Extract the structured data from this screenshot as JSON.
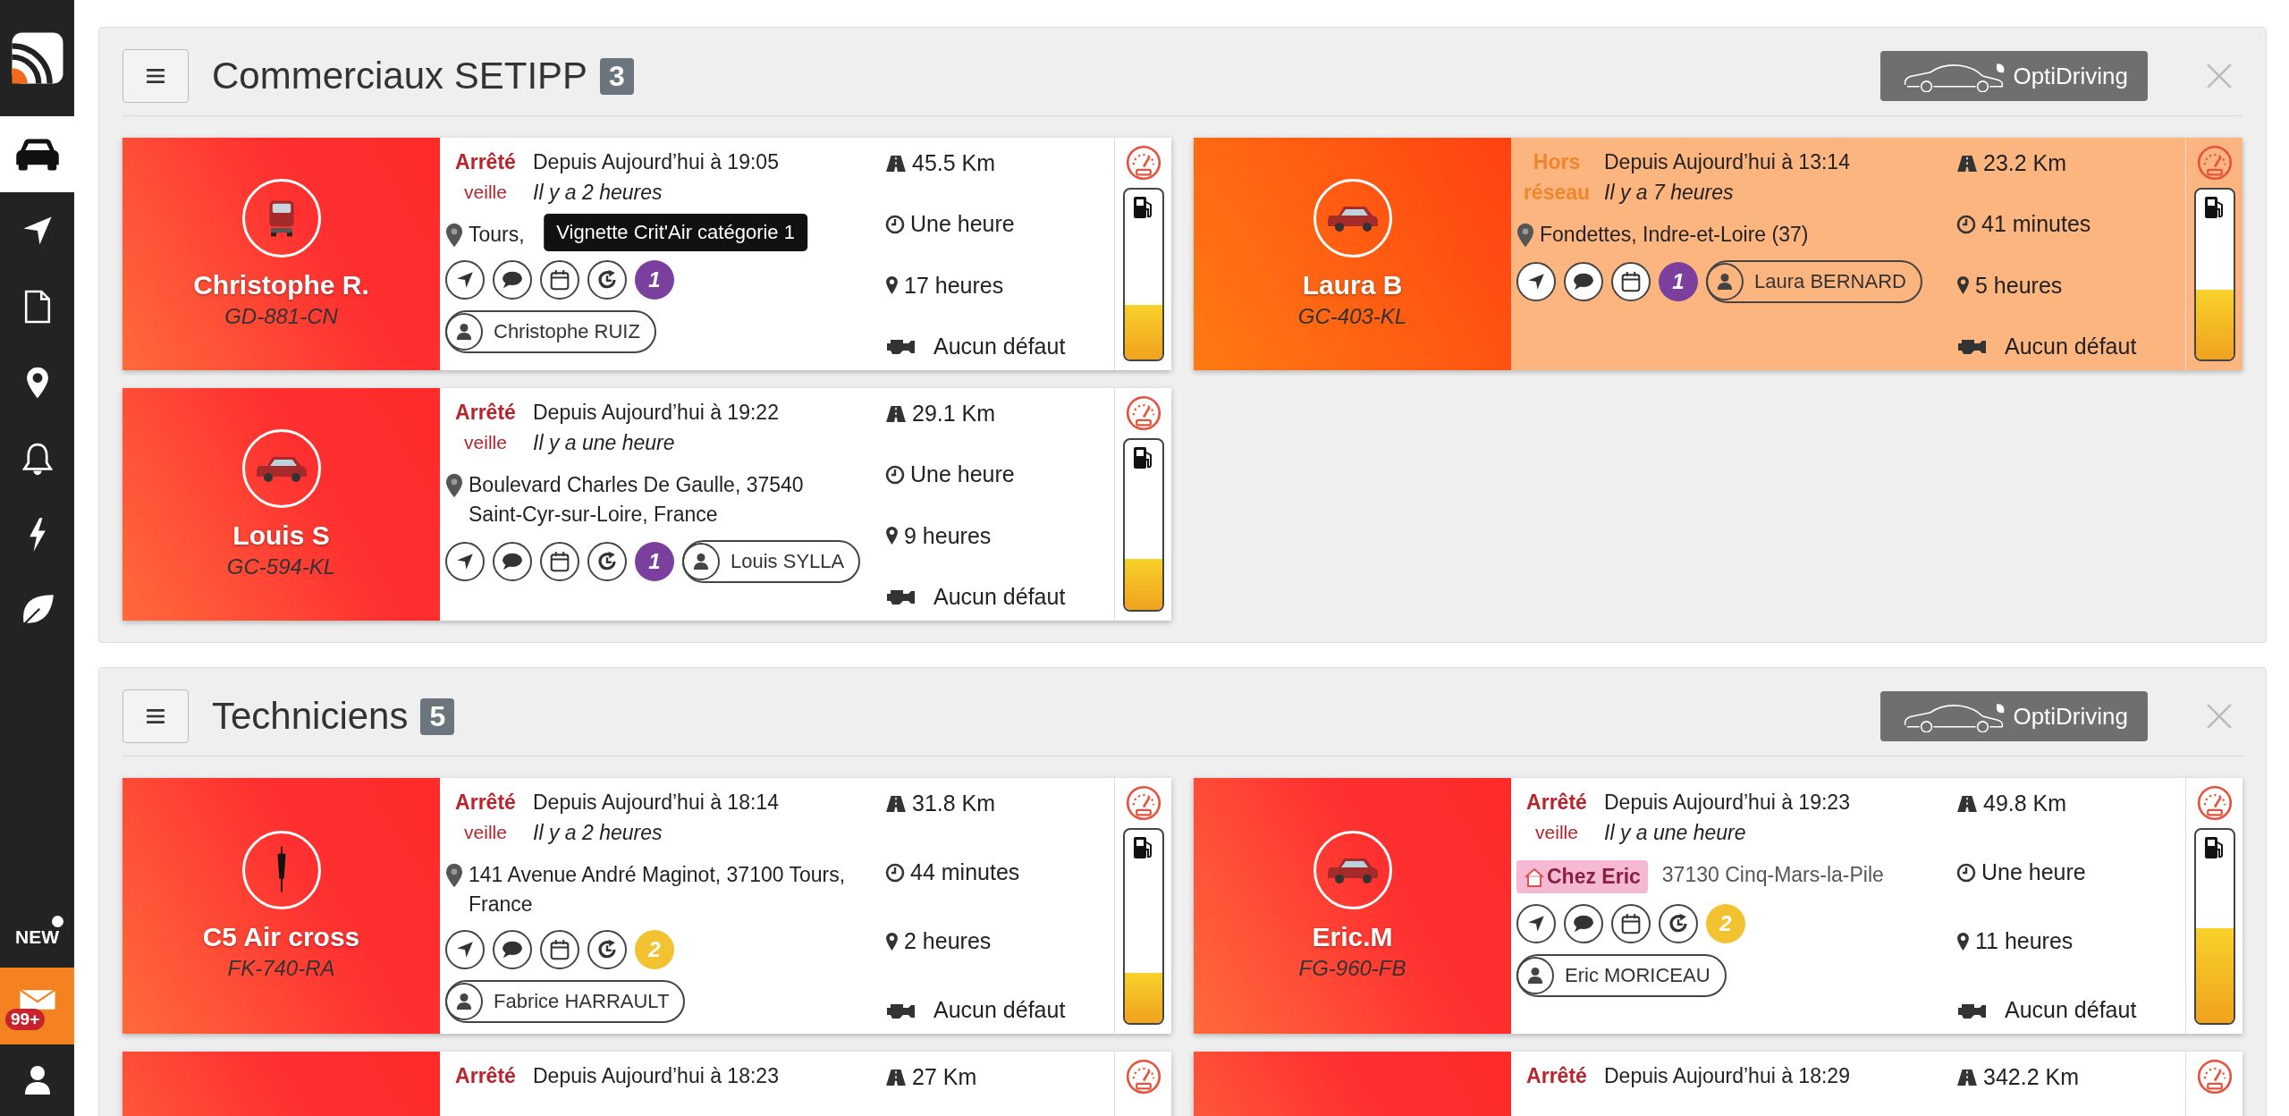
{
  "sidebar": {
    "nav": [
      {
        "kind": "car",
        "selected": true
      },
      {
        "kind": "navigate",
        "selected": false
      },
      {
        "kind": "document",
        "selected": false
      },
      {
        "kind": "pin",
        "selected": false
      },
      {
        "kind": "bell",
        "selected": false
      },
      {
        "kind": "bolt",
        "selected": false
      },
      {
        "kind": "leaf",
        "selected": false
      }
    ],
    "new_label": "NEW",
    "mail_badge": "99+"
  },
  "groups": [
    {
      "title": "Commerciaux SETIPP",
      "count": "3",
      "optidriving": "OptiDriving",
      "cards": [
        {
          "name": "Christophe R.",
          "plate": "GD-881-CN",
          "avatar": {
            "kind": "truck"
          },
          "status": {
            "kind": "stopped",
            "label": "Arrêté",
            "sub": "veille"
          },
          "since": "Depuis Aujourd’hui à 19:05",
          "ago": "Il y a 2 heures",
          "address": [
            "Tours,"
          ],
          "tooltip": "Vignette Crit'Air catégorie 1",
          "actions": [
            {
              "kind": "navigate"
            },
            {
              "kind": "message"
            },
            {
              "kind": "calendar"
            },
            {
              "kind": "history"
            }
          ],
          "critair": {
            "label": "1",
            "color": "#7b3f9e"
          },
          "driver": "Christophe RUIZ",
          "distance": "45.5 Km",
          "duration": "Une heure",
          "stop_time": "17 heures",
          "faults": "Aucun défaut",
          "fuel": {
            "level": 0.32
          }
        },
        {
          "name": "Laura B",
          "plate": "GC-403-KL",
          "avatar": {
            "kind": "car"
          },
          "status": {
            "kind": "offline",
            "label": "Hors réseau"
          },
          "since": "Depuis Aujourd’hui à 13:14",
          "ago": "Il y a 7 heures",
          "address": [
            "Fondettes, Indre-et-Loire (37)"
          ],
          "actions": [
            {
              "kind": "navigate"
            },
            {
              "kind": "message"
            },
            {
              "kind": "calendar"
            }
          ],
          "critair": {
            "label": "1",
            "color": "#7b3f9e"
          },
          "driver": "Laura BERNARD",
          "distance": "23.2 Km",
          "duration": "41 minutes",
          "stop_time": "5 heures",
          "faults": "Aucun défaut",
          "fuel": {
            "level": 0.41
          }
        },
        {
          "name": "Louis S",
          "plate": "GC-594-KL",
          "avatar": {
            "kind": "car"
          },
          "status": {
            "kind": "stopped",
            "label": "Arrêté",
            "sub": "veille"
          },
          "since": "Depuis Aujourd’hui à 19:22",
          "ago": "Il y a une heure",
          "address": [
            "Boulevard Charles De Gaulle, 37540",
            "Saint-Cyr-sur-Loire, France"
          ],
          "actions": [
            {
              "kind": "navigate"
            },
            {
              "kind": "message"
            },
            {
              "kind": "calendar"
            },
            {
              "kind": "history"
            }
          ],
          "critair": {
            "label": "1",
            "color": "#7b3f9e"
          },
          "driver": "Louis SYLLA",
          "distance": "29.1 Km",
          "duration": "Une heure",
          "stop_time": "9 heures",
          "faults": "Aucun défaut",
          "fuel": {
            "level": 0.3
          }
        }
      ]
    },
    {
      "title": "Techniciens",
      "count": "5",
      "optidriving": "OptiDriving",
      "cards": [
        {
          "name": "C5 Air cross",
          "plate": "FK-740-RA",
          "avatar": {
            "kind": "tool"
          },
          "status": {
            "kind": "stopped",
            "label": "Arrêté",
            "sub": "veille"
          },
          "since": "Depuis Aujourd’hui à 18:14",
          "ago": "Il y a 2 heures",
          "address": [
            "141 Avenue André Maginot, 37100 Tours,",
            "France"
          ],
          "actions": [
            {
              "kind": "navigate"
            },
            {
              "kind": "message"
            },
            {
              "kind": "calendar"
            },
            {
              "kind": "history"
            }
          ],
          "critair": {
            "label": "2",
            "color": "#f2c230"
          },
          "driver": "Fabrice HARRAULT",
          "distance": "31.8 Km",
          "duration": "44 minutes",
          "stop_time": "2 heures",
          "faults": "Aucun défaut",
          "fuel": {
            "level": 0.26
          }
        },
        {
          "name": "Eric.M",
          "plate": "FG-960-FB",
          "avatar": {
            "kind": "car"
          },
          "status": {
            "kind": "stopped",
            "label": "Arrêté",
            "sub": "veille"
          },
          "since": "Depuis Aujourd’hui à 19:23",
          "ago": "Il y a une heure",
          "place_tag": "Chez Eric",
          "address": [
            "37130 Cinq-Mars-la-Pile"
          ],
          "actions": [
            {
              "kind": "navigate"
            },
            {
              "kind": "message"
            },
            {
              "kind": "calendar"
            },
            {
              "kind": "history"
            }
          ],
          "critair": {
            "label": "2",
            "color": "#f2c230"
          },
          "driver": "Eric MORICEAU",
          "distance": "49.8 Km",
          "duration": "Une heure",
          "stop_time": "11 heures",
          "faults": "Aucun défaut",
          "fuel": {
            "level": 0.49
          }
        },
        {
          "status": {
            "kind": "stopped",
            "label": "Arrêté"
          },
          "since": "Depuis Aujourd’hui à 18:23",
          "distance": "27 Km"
        },
        {
          "status": {
            "kind": "stopped",
            "label": "Arrêté"
          },
          "since": "Depuis Aujourd’hui à 18:29",
          "distance": "342.2 Km"
        }
      ]
    }
  ]
}
